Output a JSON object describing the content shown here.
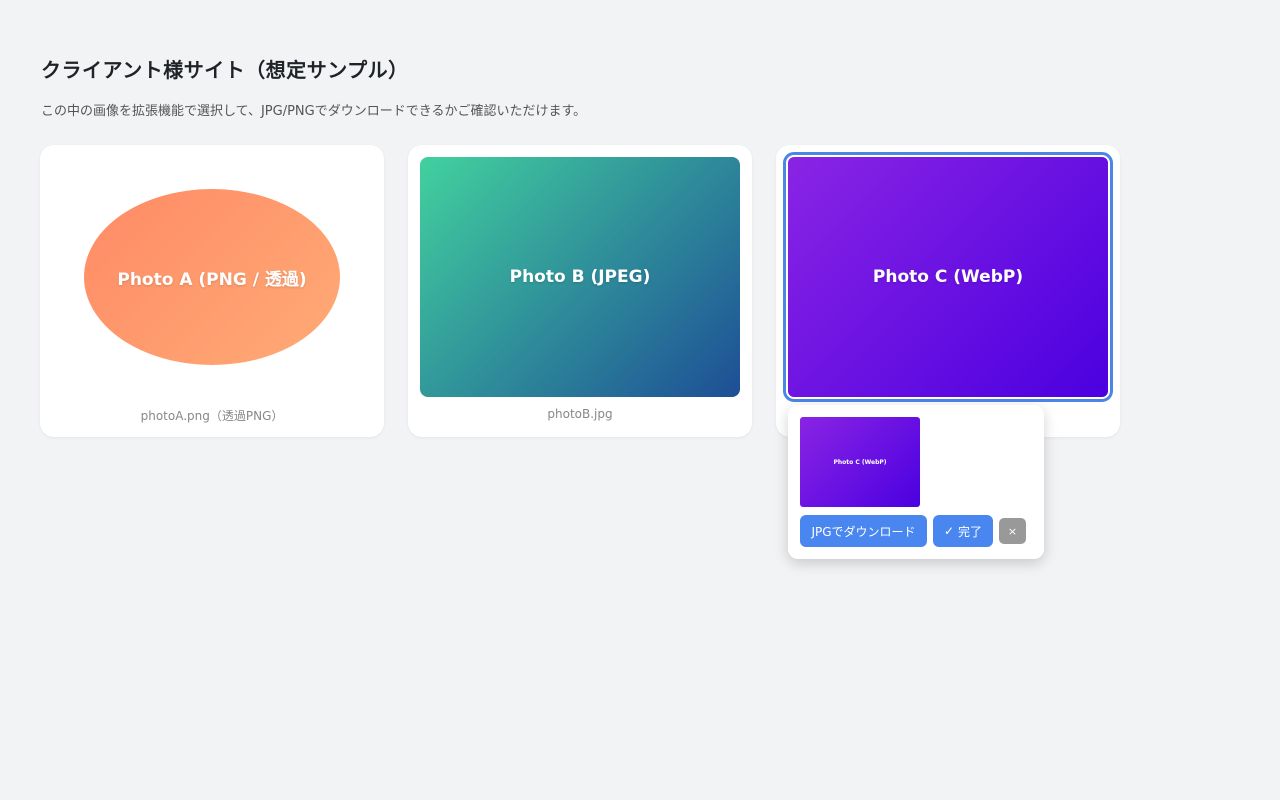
{
  "page": {
    "title": "クライアント様サイト（想定サンプル）",
    "subtitle": "この中の画像を拡張機能で選択して、JPG/PNGでダウンロードできるかご確認いただけます。"
  },
  "cards": [
    {
      "image_label": "Photo A (PNG / 透過)",
      "caption": "photoA.png（透過PNG）",
      "shape": "ellipse",
      "colors": [
        "#ff8a65",
        "#ffab76"
      ]
    },
    {
      "image_label": "Photo B (JPEG)",
      "caption": "photoB.jpg",
      "shape": "rounded-rect",
      "colors": [
        "#42d19e",
        "#1d4e96"
      ]
    },
    {
      "image_label": "Photo C (WebP)",
      "shape": "rounded-rect",
      "selected": true,
      "colors": [
        "#8a24e4",
        "#4b00e0"
      ]
    }
  ],
  "popup": {
    "thumb_label": "Photo C (WebP)",
    "download_button": "JPGでダウンロード",
    "done_icon": "✓",
    "done_label": "完了",
    "close_icon": "×"
  },
  "colors": {
    "background": "#f2f3f5",
    "accent": "#4a86f0",
    "selection_outline": "#4a86e8",
    "close_button": "#999999"
  }
}
